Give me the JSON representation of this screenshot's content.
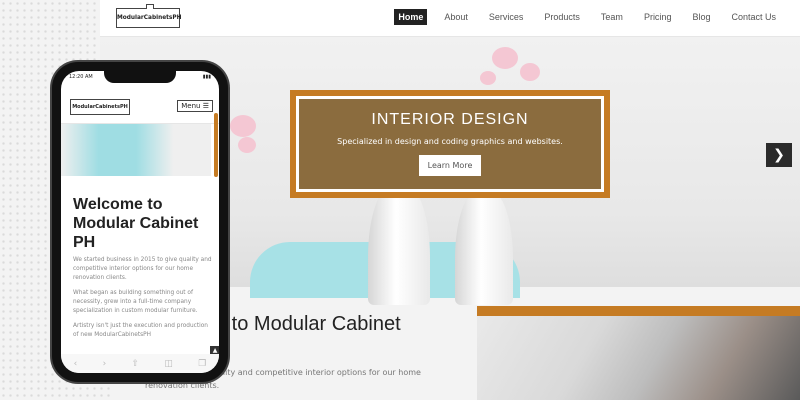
{
  "desktop": {
    "logo_text": "ModularCabinetsPH",
    "nav": [
      "Home",
      "About",
      "Services",
      "Products",
      "Team",
      "Pricing",
      "Blog",
      "Contact Us"
    ],
    "active_nav": "Home",
    "hero": {
      "title": "INTERIOR DESIGN",
      "subtitle": "Specialized in design and coding graphics and websites.",
      "button": "Learn More"
    },
    "next_icon": "chevron-right-icon",
    "welcome_heading": "e to Modular Cabinet",
    "welcome_para": "in 2015 to give quality and competitive interior options for our home renovation clients."
  },
  "mobile": {
    "time": "12:20 AM",
    "logo_text": "ModularCabinetsPH",
    "menu_label": "Menu ☰",
    "title": "Welcome to Modular Cabinet PH",
    "paragraphs": [
      "We started business in 2015 to give quality and competitive interior options for our home renovation clients.",
      "What began as building something out of necessity, grew into a full-time company specialization in custom modular furniture.",
      "Artistry isn't just the execution and production of new ModularCabinetsPH"
    ],
    "to_top_icon": "chevron-up-icon",
    "bottom_icons": [
      "back-icon",
      "forward-icon",
      "share-icon",
      "book-icon",
      "tabs-icon"
    ]
  },
  "colors": {
    "accent": "#c57b23",
    "hero_panel": "#8b6c3e",
    "nav_active": "#222222"
  }
}
